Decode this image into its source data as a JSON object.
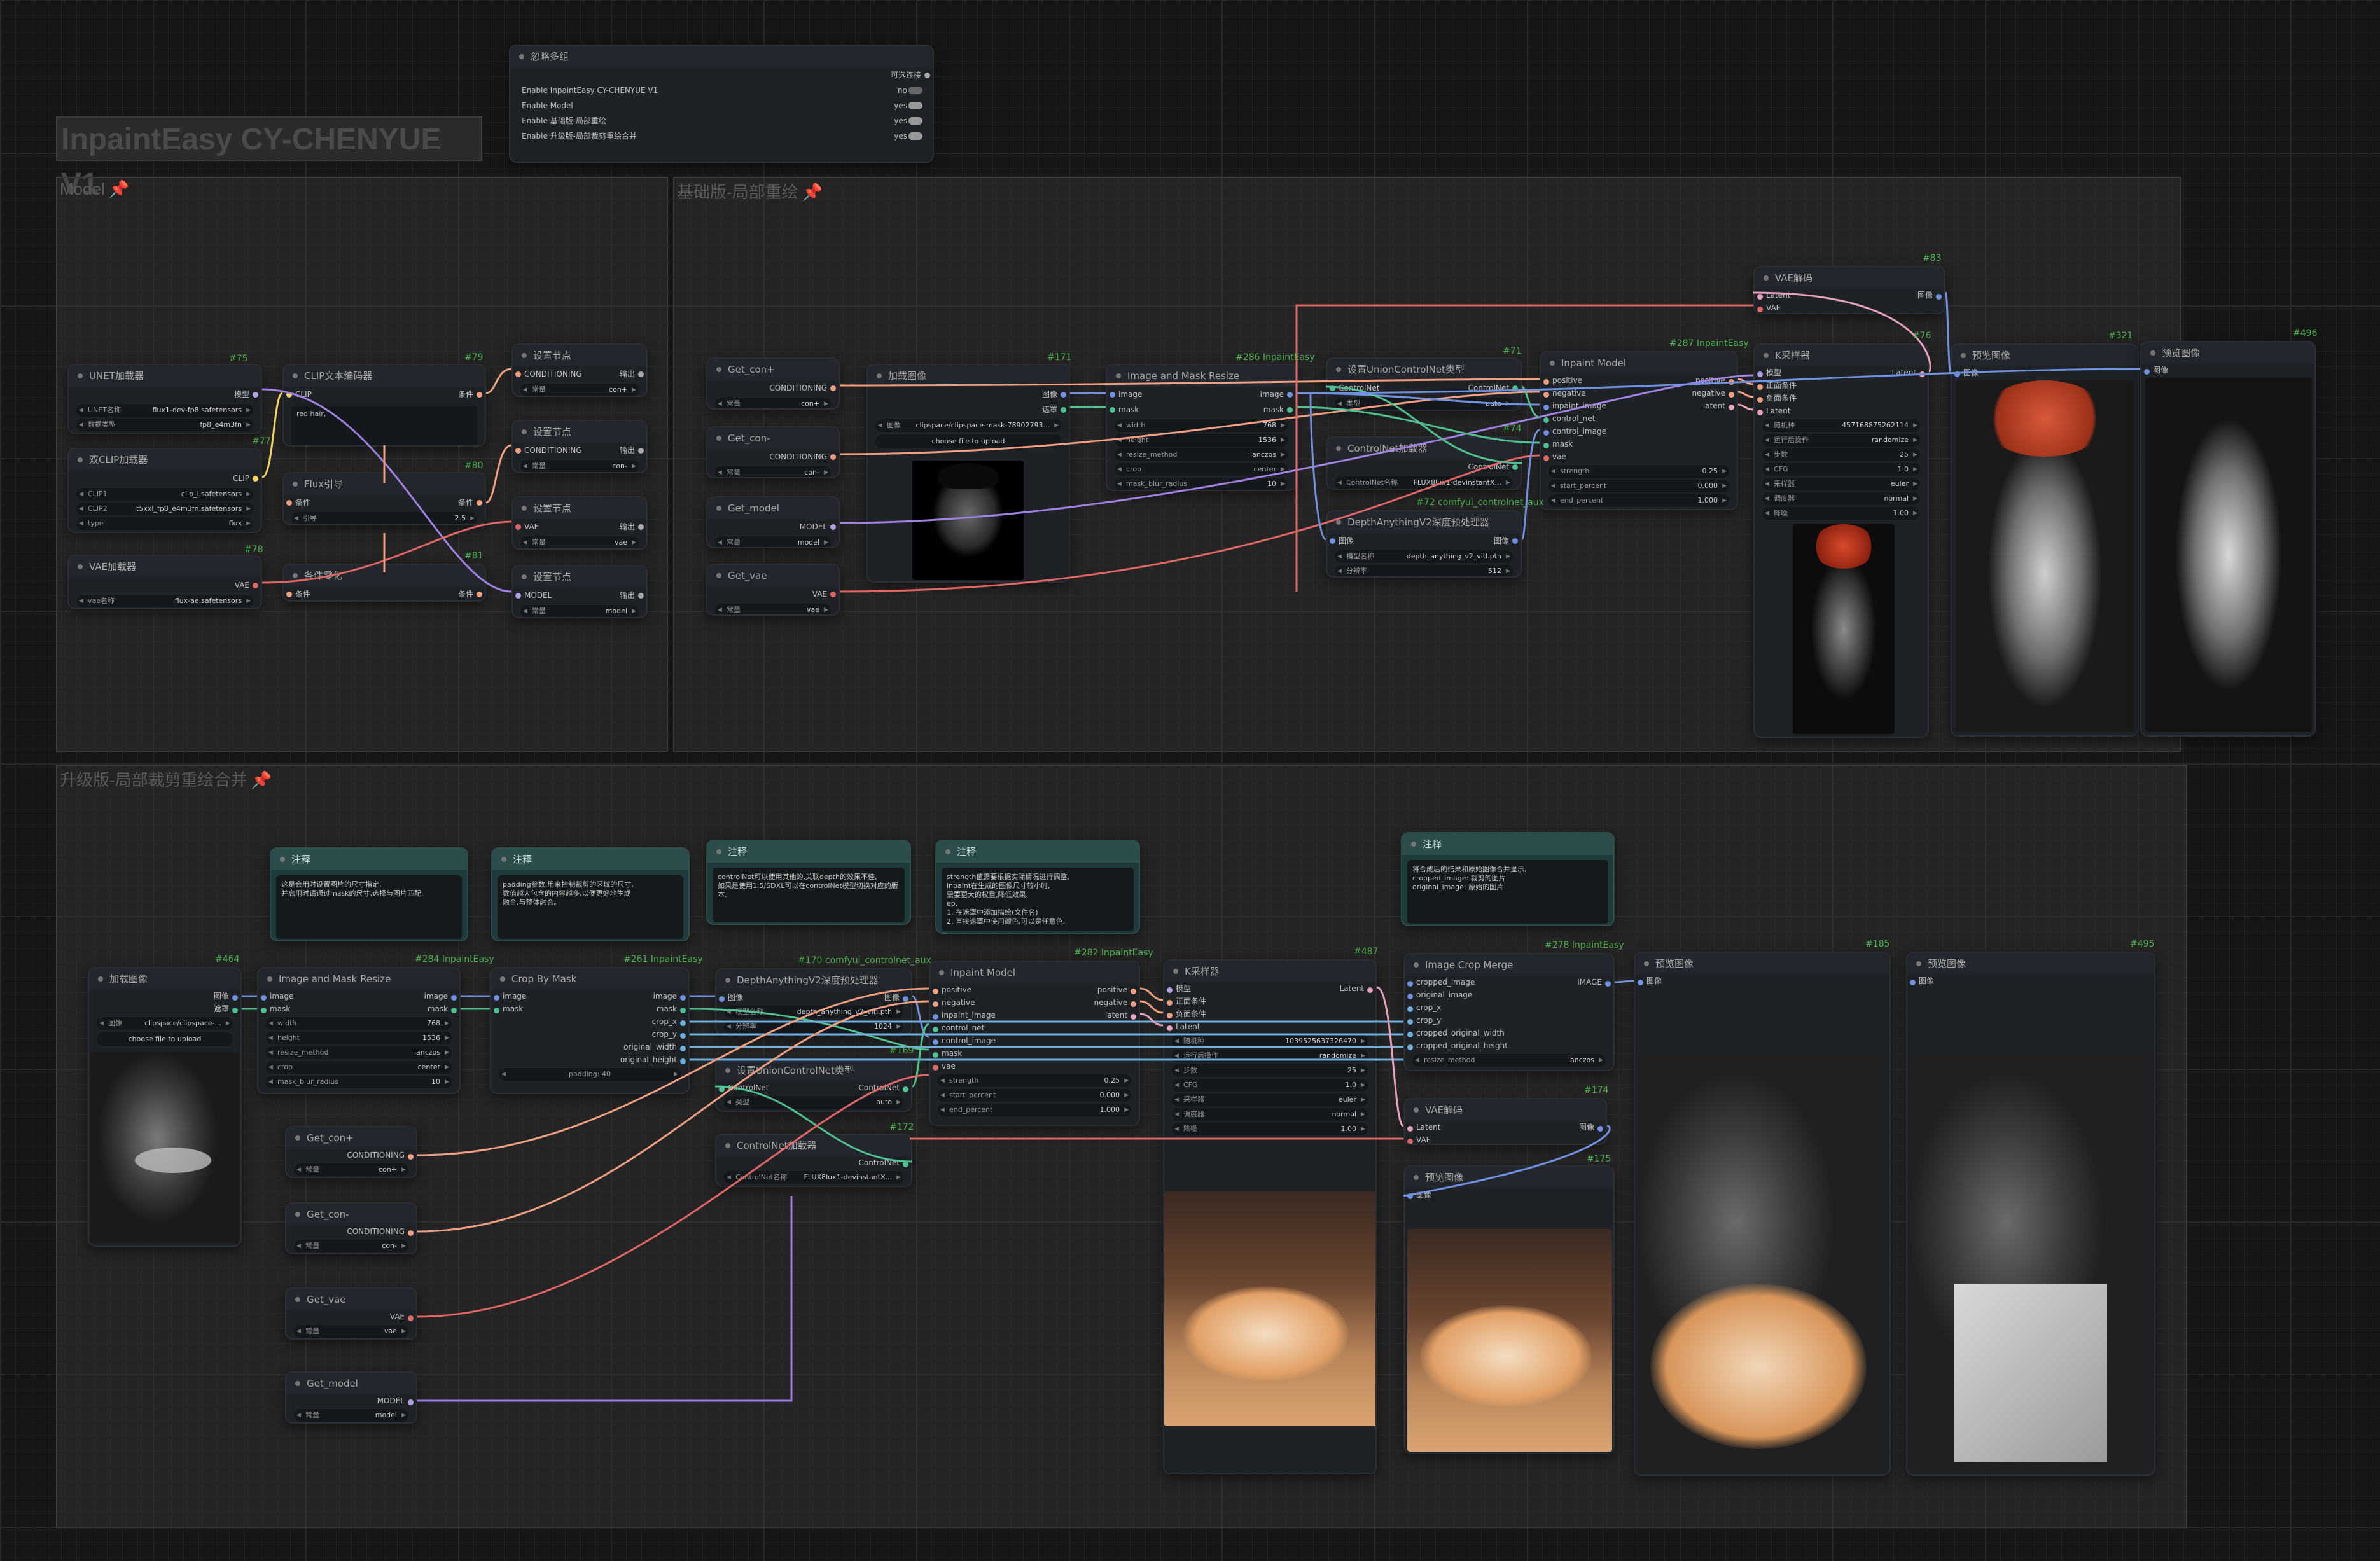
{
  "app": {
    "title": "InpaintEasy CY-CHENYUE V1"
  },
  "groups": {
    "model": "Model",
    "basic": "基础版-局部重绘",
    "advanced": "升级版-局部裁剪重绘合并"
  },
  "nodes": {
    "bypass": {
      "id": "#302",
      "title": "忽略多组",
      "top_label": "可选连接",
      "rows": [
        {
          "label": "Enable InpaintEasy CY-CHENYUE V1",
          "value": "no"
        },
        {
          "label": "Enable Model",
          "value": "yes"
        },
        {
          "label": "Enable 基础版-局部重绘",
          "value": "yes"
        },
        {
          "label": "Enable 升级版-局部裁剪重绘合并",
          "value": "yes"
        }
      ]
    },
    "unet": {
      "id": "#75",
      "title": "UNET加载器",
      "out": "模型",
      "w1_label": "UNET名称",
      "w1_value": "flux1-dev-fp8.safetensors",
      "w2_label": "数据类型",
      "w2_value": "fp8_e4m3fn"
    },
    "dualclip": {
      "id": "#77",
      "title": "双CLIP加载器",
      "out": "CLIP",
      "w1_label": "CLIP1",
      "w1_value": "clip_l.safetensors",
      "w2_label": "CLIP2",
      "w2_value": "t5xxl_fp8_e4m3fn.safetensors",
      "w3_label": "type",
      "w3_value": "flux"
    },
    "vaeloader": {
      "id": "#78",
      "title": "VAE加载器",
      "out": "VAE",
      "w1_label": "vae名称",
      "w1_value": "flux-ae.safetensors"
    },
    "cliptext": {
      "id": "#79",
      "title": "CLIP文本编码器",
      "in": "CLIP",
      "out": "条件",
      "text": "red hair,"
    },
    "flux": {
      "id": "#80",
      "title": "Flux引导",
      "in": "条件",
      "out": "条件",
      "w1_label": "引导",
      "w1_value": "2.5"
    },
    "zero": {
      "id": "#81",
      "title": "条件零化",
      "in": "条件",
      "out": "条件"
    },
    "set1": {
      "title": "设置节点",
      "in": "CONDITIONING",
      "out": "输出",
      "w_label": "常量",
      "w_value": "con+"
    },
    "set2": {
      "title": "设置节点",
      "in": "CONDITIONING",
      "out": "输出",
      "w_label": "常量",
      "w_value": "con-"
    },
    "set3": {
      "title": "设置节点",
      "in": "VAE",
      "out": "输出",
      "w_label": "常量",
      "w_value": "vae"
    },
    "set4": {
      "title": "设置节点",
      "in": "MODEL",
      "out": "输出",
      "w_label": "常量",
      "w_value": "model"
    },
    "getconp": {
      "title": "Get_con+",
      "out": "CONDITIONING",
      "w_label": "常量",
      "w_value": "con+"
    },
    "getconm": {
      "title": "Get_con-",
      "out": "CONDITIONING",
      "w_label": "常量",
      "w_value": "con-"
    },
    "getmodel": {
      "title": "Get_model",
      "out": "MODEL",
      "w_label": "常量",
      "w_value": "model"
    },
    "getvae": {
      "title": "Get_vae",
      "out": "VAE",
      "w_label": "常量",
      "w_value": "vae"
    },
    "loadimg1": {
      "id": "#171",
      "title": "加载图像",
      "out1": "图像",
      "out2": "遮罩",
      "w_label": "图像",
      "w_value": "clipspace/clipspace-mask-78902793...",
      "upload": "choose file to upload"
    },
    "resize1": {
      "id": "#286 InpaintEasy",
      "title": "Image and Mask Resize",
      "in1": "image",
      "in2": "mask",
      "out1": "image",
      "out2": "mask",
      "widgets": [
        {
          "l": "width",
          "v": "768"
        },
        {
          "l": "height",
          "v": "1536"
        },
        {
          "l": "resize_method",
          "v": "lanczos"
        },
        {
          "l": "crop",
          "v": "center"
        },
        {
          "l": "mask_blur_radius",
          "v": "10"
        }
      ]
    },
    "unionset": {
      "id": "#71",
      "title": "设置UnionControlNet类型",
      "in": "ControlNet",
      "out": "ControlNet",
      "w_label": "类型",
      "w_value": "auto"
    },
    "cnload": {
      "id": "#74",
      "title": "ControlNet加载器",
      "out": "ControlNet",
      "w_label": "ControlNet名称",
      "w_value": "FLUX8lux1-devinstantX..."
    },
    "depth": {
      "id": "#72 comfyui_controlnet_aux",
      "title": "DepthAnythingV2深度预处理器",
      "in": "图像",
      "out": "图像",
      "widgets": [
        {
          "l": "模型名称",
          "v": "depth_anything_v2_vitl.pth"
        },
        {
          "l": "分辨率",
          "v": "512"
        }
      ]
    },
    "inpaint1": {
      "id": "#287 InpaintEasy",
      "title": "Inpaint Model",
      "ins": [
        "positive",
        "negative",
        "inpaint_image",
        "control_net",
        "control_image",
        "mask",
        "vae"
      ],
      "outs": [
        "positive",
        "negative",
        "latent"
      ],
      "widgets": [
        {
          "l": "strength",
          "v": "0.25"
        },
        {
          "l": "start_percent",
          "v": "0.000"
        },
        {
          "l": "end_percent",
          "v": "1.000"
        }
      ]
    },
    "vaedec1": {
      "id": "#83",
      "title": "VAE解码",
      "in1": "Latent",
      "in2": "VAE",
      "out": "图像"
    },
    "ksampler1": {
      "id": "#76",
      "title": "K采样器",
      "ins": [
        "模型",
        "正面条件",
        "负面条件",
        "Latent"
      ],
      "out": "Latent",
      "widgets": [
        {
          "l": "随机种",
          "v": "457168875262114"
        },
        {
          "l": "运行后操作",
          "v": "randomize"
        },
        {
          "l": "步数",
          "v": "25"
        },
        {
          "l": "CFG",
          "v": "1.0"
        },
        {
          "l": "采样器",
          "v": "euler"
        },
        {
          "l": "调度器",
          "v": "normal"
        },
        {
          "l": "降噪",
          "v": "1.00"
        }
      ]
    },
    "preview1": {
      "id": "#321",
      "title": "预览图像",
      "in": "图像"
    },
    "preview2": {
      "id": "#496",
      "title": "预览图像",
      "in": "图像"
    },
    "notes": [
      {
        "title": "注释",
        "text": "这是会用时设置图片的尺寸指定,\n并启用时请通过mask的尺寸,选择与图片匹配."
      },
      {
        "title": "注释",
        "text": "padding参数,用来控制裁剪的区域的尺寸,\n数值越大包含的内容越多,以便更好地生成\n融合,与整体融合。"
      },
      {
        "title": "注释",
        "text": "controlNet可以使用其他的,关联depth的效果不佳,\n如果是使用1.5/SDXL可以在controlNet模型切换对应的版本."
      },
      {
        "title": "注释",
        "text": "strength值需要根据实际情况进行调整,\ninpaint在生成的图像尺寸较小时,\n需要更大的权重,降低效果.\nep.\n1. 在遮罩中添加描绘(文件名)\n2. 直接遮罩中使用颜色,可以是任意色."
      },
      {
        "title": "注释",
        "text": "将合成后的结果和原始图像合并显示,\ncropped_image: 裁剪的图片\noriginal_image: 原始的图片"
      }
    ],
    "loadimg2": {
      "id": "#464",
      "title": "加载图像",
      "out1": "图像",
      "out2": "遮罩",
      "w_label": "图像",
      "w_value": "clipspace/clipspace-...",
      "upload": "choose file to upload"
    },
    "resize2": {
      "id": "#284 InpaintEasy",
      "title": "Image and Mask Resize",
      "in1": "image",
      "in2": "mask",
      "out1": "image",
      "out2": "mask",
      "widgets": [
        {
          "l": "width",
          "v": "768"
        },
        {
          "l": "height",
          "v": "1536"
        },
        {
          "l": "resize_method",
          "v": "lanczos"
        },
        {
          "l": "crop",
          "v": "center"
        },
        {
          "l": "mask_blur_radius",
          "v": "10"
        }
      ]
    },
    "cropbymask": {
      "id": "#261 InpaintEasy",
      "title": "Crop By Mask",
      "in1": "image",
      "in2": "mask",
      "outs": [
        "image",
        "mask",
        "crop_x",
        "crop_y",
        "original_width",
        "original_height"
      ],
      "w_label": "padding",
      "w_value": "40"
    },
    "depth2": {
      "id": "#170 comfyui_controlnet_aux",
      "title": "DepthAnythingV2深度预处理器",
      "in": "图像",
      "out": "图像",
      "widgets": [
        {
          "l": "模型名称",
          "v": "depth_anything_v2_vitl.pth"
        },
        {
          "l": "分辨率",
          "v": "1024"
        }
      ]
    },
    "unionset2": {
      "id": "#169",
      "title": "设置UnionControlNet类型",
      "in": "ControlNet",
      "out": "ControlNet",
      "w_label": "类型",
      "w_value": "auto"
    },
    "cnload2": {
      "id": "#172",
      "title": "ControlNet加载器",
      "out": "ControlNet",
      "w_label": "ControlNet名称",
      "w_value": "FLUX8lux1-devinstantX..."
    },
    "inpaint2": {
      "id": "#282 InpaintEasy",
      "title": "Inpaint Model",
      "ins": [
        "positive",
        "negative",
        "inpaint_image",
        "control_net",
        "control_image",
        "mask",
        "vae"
      ],
      "outs": [
        "positive",
        "negative",
        "latent"
      ],
      "widgets": [
        {
          "l": "strength",
          "v": "0.25"
        },
        {
          "l": "start_percent",
          "v": "0.000"
        },
        {
          "l": "end_percent",
          "v": "1.000"
        }
      ]
    },
    "ksampler2": {
      "id": "#487",
      "title": "K采样器",
      "ins": [
        "模型",
        "正面条件",
        "负面条件",
        "Latent"
      ],
      "out": "Latent",
      "widgets": [
        {
          "l": "随机种",
          "v": "1039525637326470"
        },
        {
          "l": "运行后操作",
          "v": "randomize"
        },
        {
          "l": "步数",
          "v": "25"
        },
        {
          "l": "CFG",
          "v": "1.0"
        },
        {
          "l": "采样器",
          "v": "euler"
        },
        {
          "l": "调度器",
          "v": "normal"
        },
        {
          "l": "降噪",
          "v": "1.00"
        }
      ]
    },
    "cropmerge": {
      "id": "#278 InpaintEasy",
      "title": "Image Crop Merge",
      "ins": [
        "cropped_image",
        "original_image",
        "crop_x",
        "crop_y",
        "cropped_original_width",
        "cropped_original_height"
      ],
      "out": "IMAGE",
      "w_label": "resize_method",
      "w_value": "lanczos"
    },
    "vaedec2": {
      "id": "#174",
      "title": "VAE解码",
      "in1": "Latent",
      "in2": "VAE",
      "out": "图像"
    },
    "preview3": {
      "id": "#175",
      "title": "预览图像",
      "in": "图像"
    },
    "preview4": {
      "id": "#185",
      "title": "预览图像",
      "in": "图像"
    },
    "preview5": {
      "id": "#495",
      "title": "预览图像",
      "in": "图像"
    },
    "getconp2": {
      "title": "Get_con+",
      "out": "CONDITIONING",
      "w_label": "常量",
      "w_value": "con+"
    },
    "getconm2": {
      "title": "Get_con-",
      "out": "CONDITIONING",
      "w_label": "常量",
      "w_value": "con-"
    },
    "getvae2": {
      "title": "Get_vae",
      "out": "VAE",
      "w_label": "常量",
      "w_value": "vae"
    },
    "getmodel2": {
      "title": "Get_model",
      "out": "MODEL",
      "w_label": "常量",
      "w_value": "model"
    }
  },
  "colors": {
    "wire_red": "#e06666",
    "wire_pink": "#e6a0c0",
    "wire_yellow": "#f0d060",
    "wire_green": "#4fc090",
    "wire_blue": "#7090e0",
    "wire_lavender": "#a080e0",
    "wire_orange": "#e09050",
    "id_green": "#4caf50"
  }
}
